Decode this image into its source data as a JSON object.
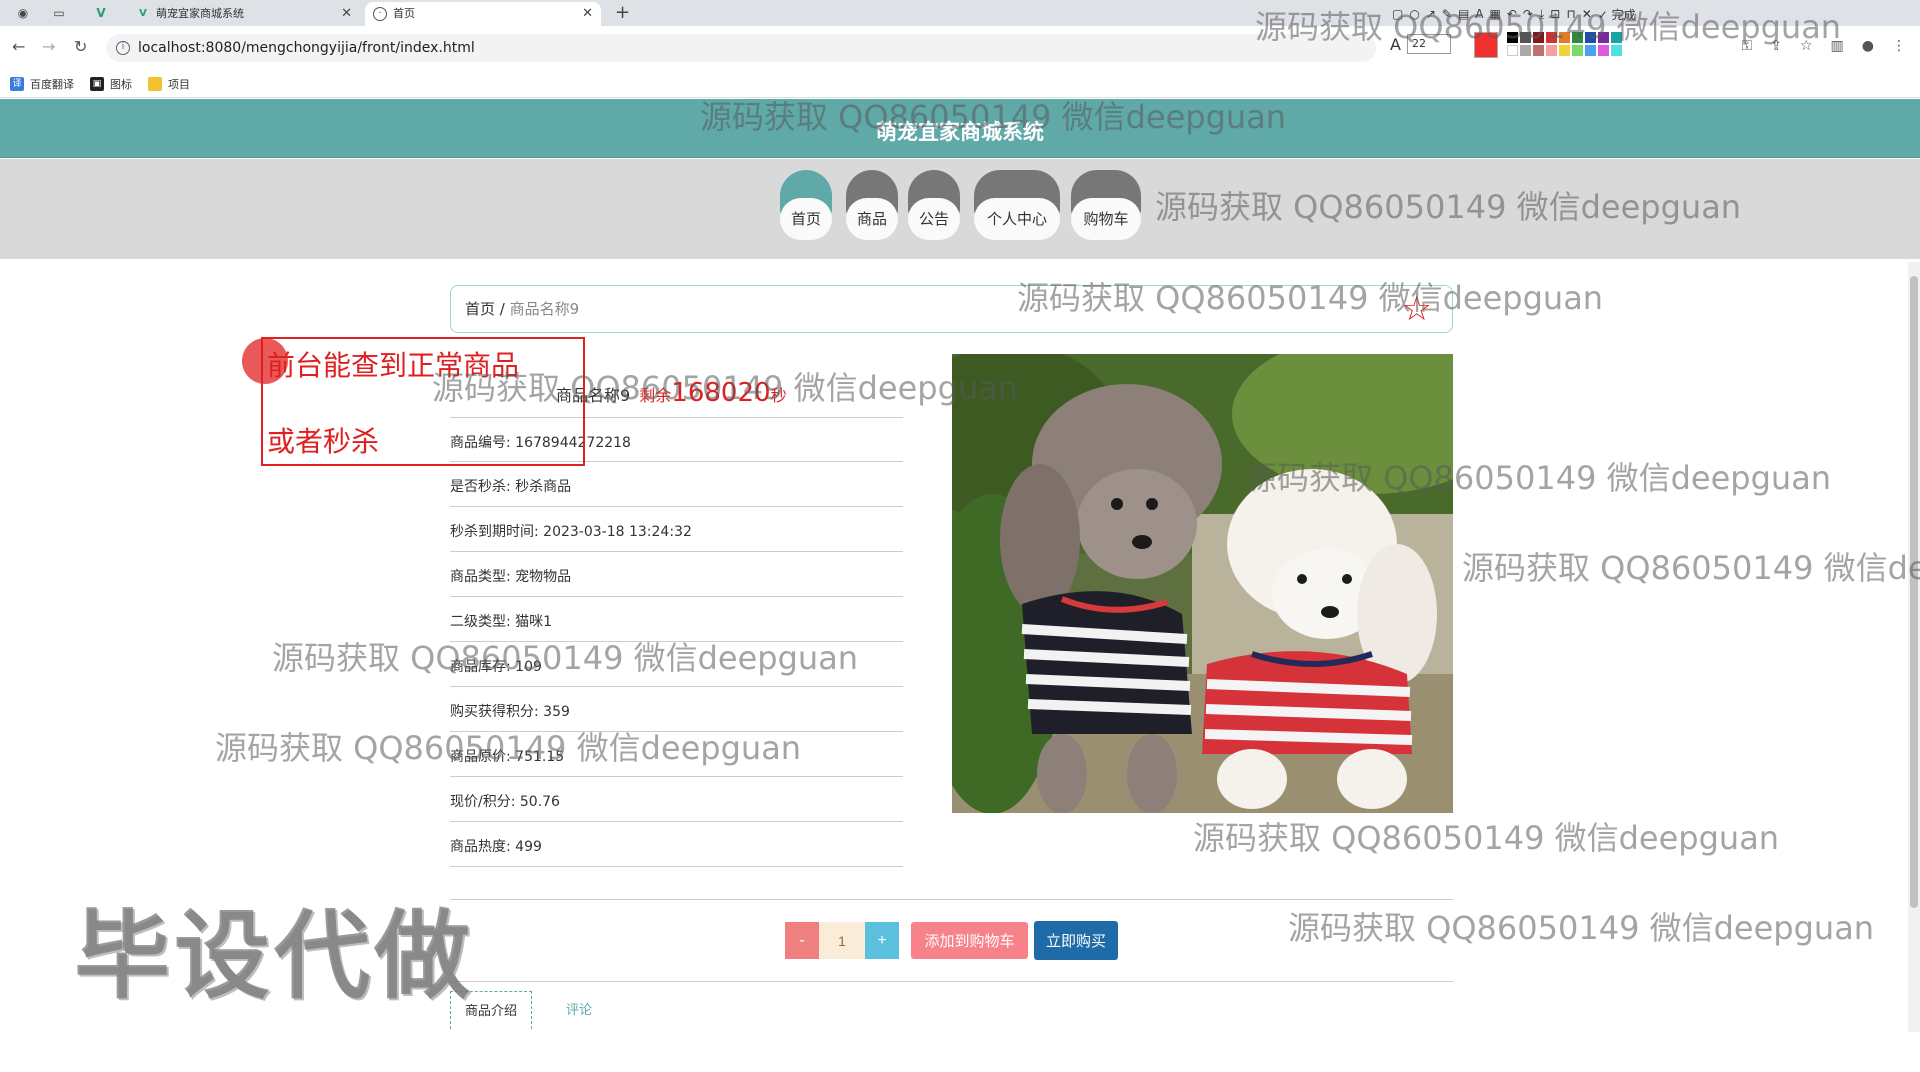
{
  "browser": {
    "tabs": [
      {
        "title": "萌宠宜家商城系统",
        "active": false
      },
      {
        "title": "首页",
        "active": true
      }
    ],
    "url": "localhost:8080/mengchongyijia/front/index.html",
    "font_size_value": "22",
    "done_label": "完成",
    "bookmarks": [
      "百度翻译",
      "图标",
      "项目"
    ]
  },
  "site": {
    "title": "萌宠宜家商城系统",
    "nav": [
      {
        "label": "首页",
        "active": true
      },
      {
        "label": "商品",
        "active": false
      },
      {
        "label": "公告",
        "active": false
      },
      {
        "label": "个人中心",
        "active": false
      },
      {
        "label": "购物车",
        "active": false
      }
    ]
  },
  "breadcrumb": {
    "home": "首页",
    "separator": " / ",
    "current": "商品名称9"
  },
  "product": {
    "name": "商品名称9",
    "seckill_prefix": "剩余",
    "countdown": "168020",
    "countdown_unit": "秒",
    "fields": [
      "商品编号: 1678944272218",
      "是否秒杀: 秒杀商品",
      "秒杀到期时间: 2023-03-18 13:24:32",
      "商品类型: 宠物物品",
      "二级类型: 猫咪1",
      "商品库存: 109",
      "购买获得积分: 359",
      "商品原价: 751.15",
      "现价/积分: 50.76",
      "商品热度: 499"
    ],
    "quantity": "1",
    "minus_label": "-",
    "plus_label": "+",
    "add_to_cart_label": "添加到购物车",
    "buy_now_label": "立即购买",
    "tabs": [
      {
        "label": "商品介绍",
        "active": true
      },
      {
        "label": "评论",
        "active": false
      }
    ]
  },
  "annotation": {
    "line1": "前台能查到正常商品",
    "line2": "或者秒杀"
  },
  "watermarks": {
    "text": "源码获取 QQ86050149 微信deepguan",
    "big": "毕设代做"
  },
  "colors": {
    "header_teal": "#5fa9a8",
    "accent_red": "#e02020",
    "buy_blue": "#1e6ba8",
    "cart_pink": "#f7828a"
  }
}
